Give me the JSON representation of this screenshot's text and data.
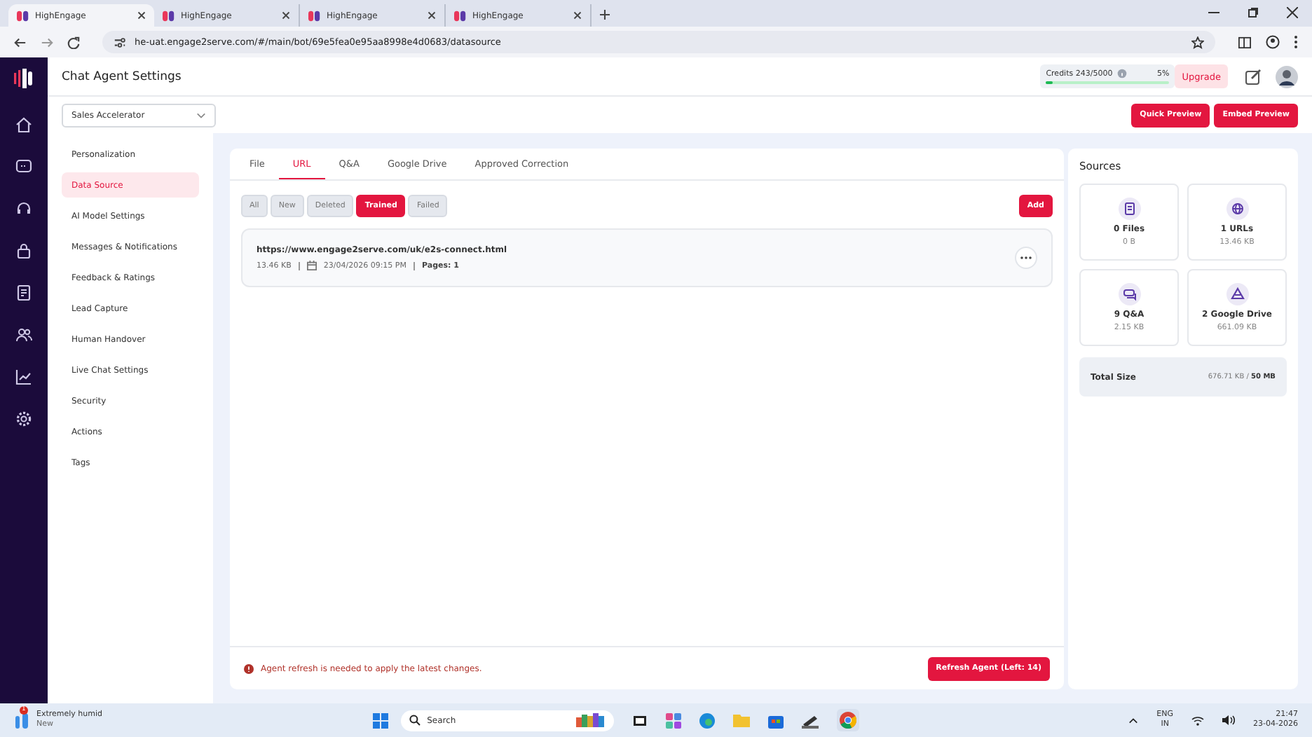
{
  "browser": {
    "tabs": [
      {
        "title": "HighEngage",
        "selected": true
      },
      {
        "title": "HighEngage",
        "selected": false
      },
      {
        "title": "HighEngage",
        "selected": false
      },
      {
        "title": "HighEngage",
        "selected": false
      }
    ],
    "url": "he-uat.engage2serve.com/#/main/bot/69e5fea0e95aa8998e4d0683/datasource"
  },
  "header": {
    "title": "Chat Agent Settings",
    "credits": {
      "label": "Credits",
      "value": "243/5000",
      "percent": "5%",
      "level": 0.05
    },
    "upgrade": "Upgrade"
  },
  "agent_select": {
    "value": "Sales Accelerator"
  },
  "preview_buttons": [
    "Quick Preview",
    "Embed Preview"
  ],
  "settings_menu": [
    {
      "label": "Personalization",
      "selected": false
    },
    {
      "label": "Data Source",
      "selected": true
    },
    {
      "label": "AI Model Settings",
      "selected": false
    },
    {
      "label": "Messages & Notifications",
      "selected": false
    },
    {
      "label": "Feedback & Ratings",
      "selected": false
    },
    {
      "label": "Lead Capture",
      "selected": false
    },
    {
      "label": "Human Handover",
      "selected": false
    },
    {
      "label": "Live Chat Settings",
      "selected": false
    },
    {
      "label": "Security",
      "selected": false
    },
    {
      "label": "Actions",
      "selected": false
    },
    {
      "label": "Tags",
      "selected": false
    }
  ],
  "source_tabs": [
    {
      "label": "File",
      "selected": false
    },
    {
      "label": "URL",
      "selected": true
    },
    {
      "label": "Q&A",
      "selected": false
    },
    {
      "label": "Google Drive",
      "selected": false
    },
    {
      "label": "Approved Correction",
      "selected": false
    }
  ],
  "filters": [
    {
      "label": "All",
      "selected": false
    },
    {
      "label": "New",
      "selected": false
    },
    {
      "label": "Deleted",
      "selected": false
    },
    {
      "label": "Trained",
      "selected": true
    },
    {
      "label": "Failed",
      "selected": false
    }
  ],
  "add_button": "Add",
  "items": [
    {
      "url": "https://www.engage2serve.com/uk/e2s-connect.html",
      "size": "13.46 KB",
      "date": "23/04/2026 09:15 PM",
      "pages": "Pages: 1"
    }
  ],
  "notice": {
    "text": "Agent refresh is needed to apply the latest changes.",
    "button": "Refresh Agent (Left: 14)"
  },
  "sources": {
    "title": "Sources",
    "cards": [
      {
        "kind": "file",
        "title": "0 Files",
        "size": "0 B"
      },
      {
        "kind": "url",
        "title": "1 URLs",
        "size": "13.46 KB"
      },
      {
        "kind": "qa",
        "title": "9 Q&A",
        "size": "2.15 KB"
      },
      {
        "kind": "drive",
        "title": "2 Google Drive",
        "size": "661.09 KB"
      }
    ],
    "total": {
      "label": "Total Size",
      "value": "676.71 KB / **50 MB**"
    }
  },
  "taskbar": {
    "weather": {
      "badge": "1",
      "title": "Extremely humid",
      "subtitle": "New"
    },
    "search": "Search",
    "lang": "ENG",
    "region": "IN",
    "time": "21:47",
    "date": "23-04-2026"
  }
}
